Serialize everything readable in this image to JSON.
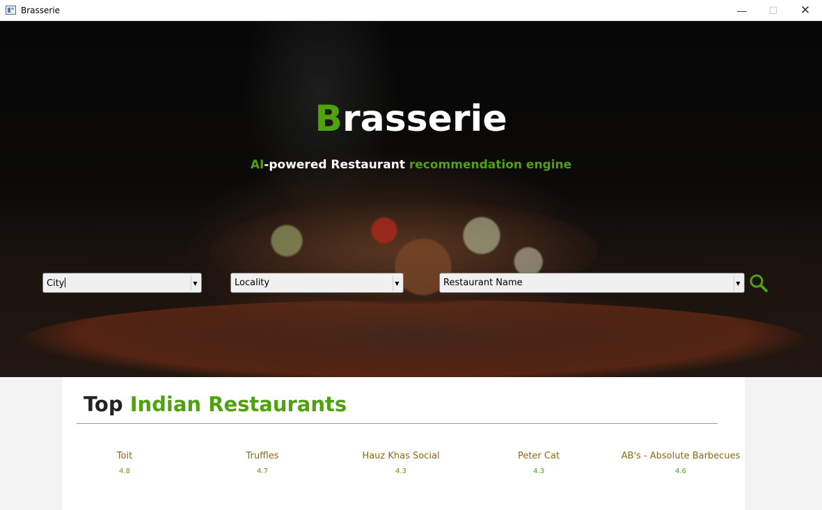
{
  "window": {
    "title": "Brasserie",
    "minimize": "—",
    "maximize": "☐",
    "close": "✕"
  },
  "hero": {
    "brand_first": "B",
    "brand_rest": "rasserie",
    "tagline": {
      "ai": "AI",
      "mid": "-powered Restaurant ",
      "end": "recommendation engine"
    }
  },
  "search": {
    "city": "City",
    "locality": "Locality",
    "restaurant_name": "Restaurant Name",
    "dropdown_arrow": "▼"
  },
  "section": {
    "title_word": "Top ",
    "title_highlight": "Indian Restaurants"
  },
  "restaurants": [
    {
      "name": "Toit",
      "rating": "4.8"
    },
    {
      "name": "Truffles",
      "rating": "4.7"
    },
    {
      "name": "Hauz Khas Social",
      "rating": "4.3"
    },
    {
      "name": "Peter Cat",
      "rating": "4.3"
    },
    {
      "name": "AB's - Absolute Barbecues",
      "rating": "4.6"
    }
  ],
  "colors": {
    "accent": "#4fa10d",
    "restaurant_name": "#8a6a10"
  }
}
